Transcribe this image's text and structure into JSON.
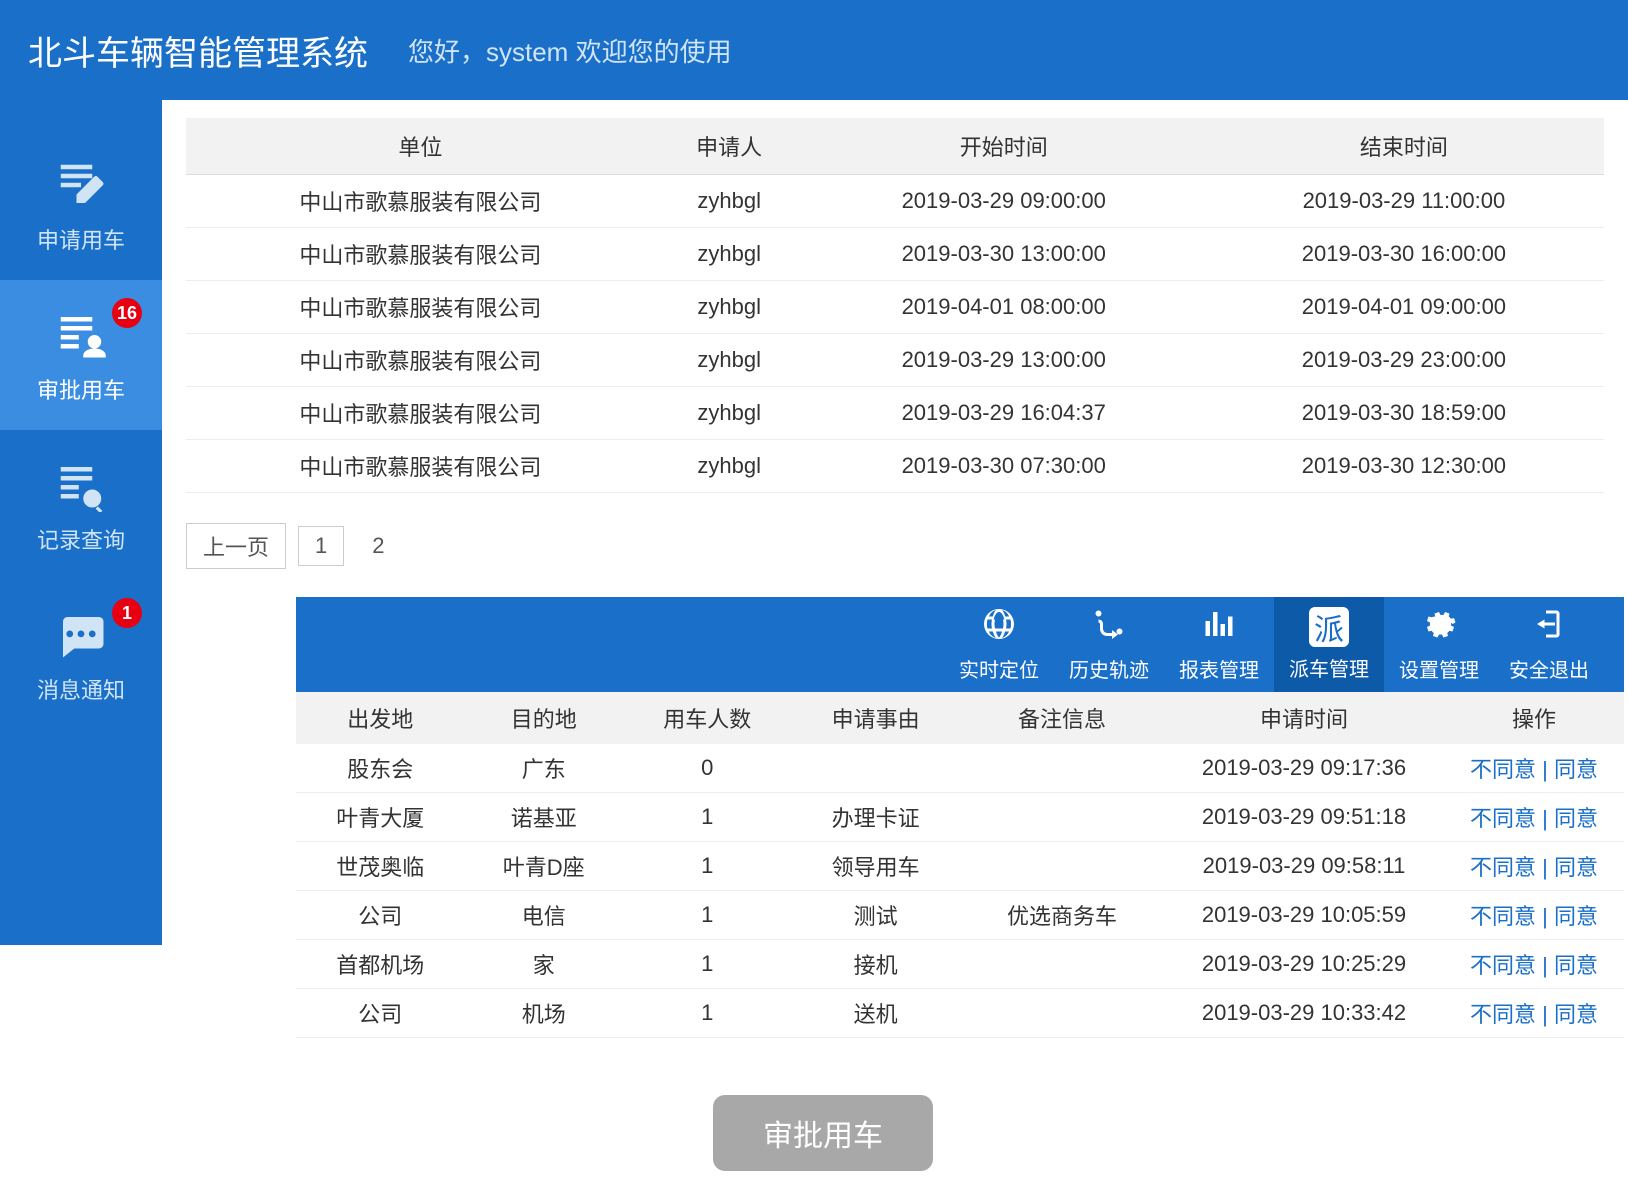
{
  "header": {
    "title": "北斗车辆智能管理系统",
    "welcome": "您好，system 欢迎您的使用"
  },
  "sidebar": {
    "items": [
      {
        "label": "申请用车",
        "icon": "edit-note-icon",
        "badge": null,
        "active": false
      },
      {
        "label": "审批用车",
        "icon": "list-user-icon",
        "badge": "16",
        "active": true
      },
      {
        "label": "记录查询",
        "icon": "list-search-icon",
        "badge": null,
        "active": false
      },
      {
        "label": "消息通知",
        "icon": "chat-icon",
        "badge": "1",
        "active": false
      }
    ]
  },
  "table1": {
    "headers": [
      "单位",
      "申请人",
      "开始时间",
      "结束时间"
    ],
    "rows": [
      [
        "中山市歌慕服装有限公司",
        "zyhbgl",
        "2019-03-29 09:00:00",
        "2019-03-29 11:00:00"
      ],
      [
        "中山市歌慕服装有限公司",
        "zyhbgl",
        "2019-03-30 13:00:00",
        "2019-03-30 16:00:00"
      ],
      [
        "中山市歌慕服装有限公司",
        "zyhbgl",
        "2019-04-01 08:00:00",
        "2019-04-01 09:00:00"
      ],
      [
        "中山市歌慕服装有限公司",
        "zyhbgl",
        "2019-03-29 13:00:00",
        "2019-03-29 23:00:00"
      ],
      [
        "中山市歌慕服装有限公司",
        "zyhbgl",
        "2019-03-29 16:04:37",
        "2019-03-30 18:59:00"
      ],
      [
        "中山市歌慕服装有限公司",
        "zyhbgl",
        "2019-03-30 07:30:00",
        "2019-03-30 12:30:00"
      ]
    ]
  },
  "pager": {
    "prev": "上一页",
    "p1": "1",
    "p2": "2"
  },
  "toolbar": {
    "items": [
      {
        "label": "实时定位",
        "icon": "globe-icon",
        "active": false
      },
      {
        "label": "历史轨迹",
        "icon": "route-icon",
        "active": false
      },
      {
        "label": "报表管理",
        "icon": "bar-chart-icon",
        "active": false
      },
      {
        "label": "派车管理",
        "icon": "pai-icon",
        "active": true
      },
      {
        "label": "设置管理",
        "icon": "gear-icon",
        "active": false
      },
      {
        "label": "安全退出",
        "icon": "logout-icon",
        "active": false
      }
    ]
  },
  "table2": {
    "headers": [
      "出发地",
      "目的地",
      "用车人数",
      "申请事由",
      "备注信息",
      "申请时间",
      "操作"
    ],
    "rows": [
      {
        "c": [
          "股东会",
          "广东",
          "0",
          "",
          "",
          "2019-03-29 09:17:36"
        ],
        "reject": "不同意",
        "approve": "同意"
      },
      {
        "c": [
          "叶青大厦",
          "诺基亚",
          "1",
          "办理卡证",
          "",
          "2019-03-29 09:51:18"
        ],
        "reject": "不同意",
        "approve": "同意"
      },
      {
        "c": [
          "世茂奥临",
          "叶青D座",
          "1",
          "领导用车",
          "",
          "2019-03-29 09:58:11"
        ],
        "reject": "不同意",
        "approve": "同意"
      },
      {
        "c": [
          "公司",
          "电信",
          "1",
          "测试",
          "优选商务车",
          "2019-03-29 10:05:59"
        ],
        "reject": "不同意",
        "approve": "同意"
      },
      {
        "c": [
          "首都机场",
          "家",
          "1",
          "接机",
          "",
          "2019-03-29 10:25:29"
        ],
        "reject": "不同意",
        "approve": "同意"
      },
      {
        "c": [
          "公司",
          "机场",
          "1",
          "送机",
          "",
          "2019-03-29 10:33:42"
        ],
        "reject": "不同意",
        "approve": "同意"
      }
    ]
  },
  "bottom_chip": "审批用车",
  "action_sep": " | ",
  "toolbar_pai": "派"
}
